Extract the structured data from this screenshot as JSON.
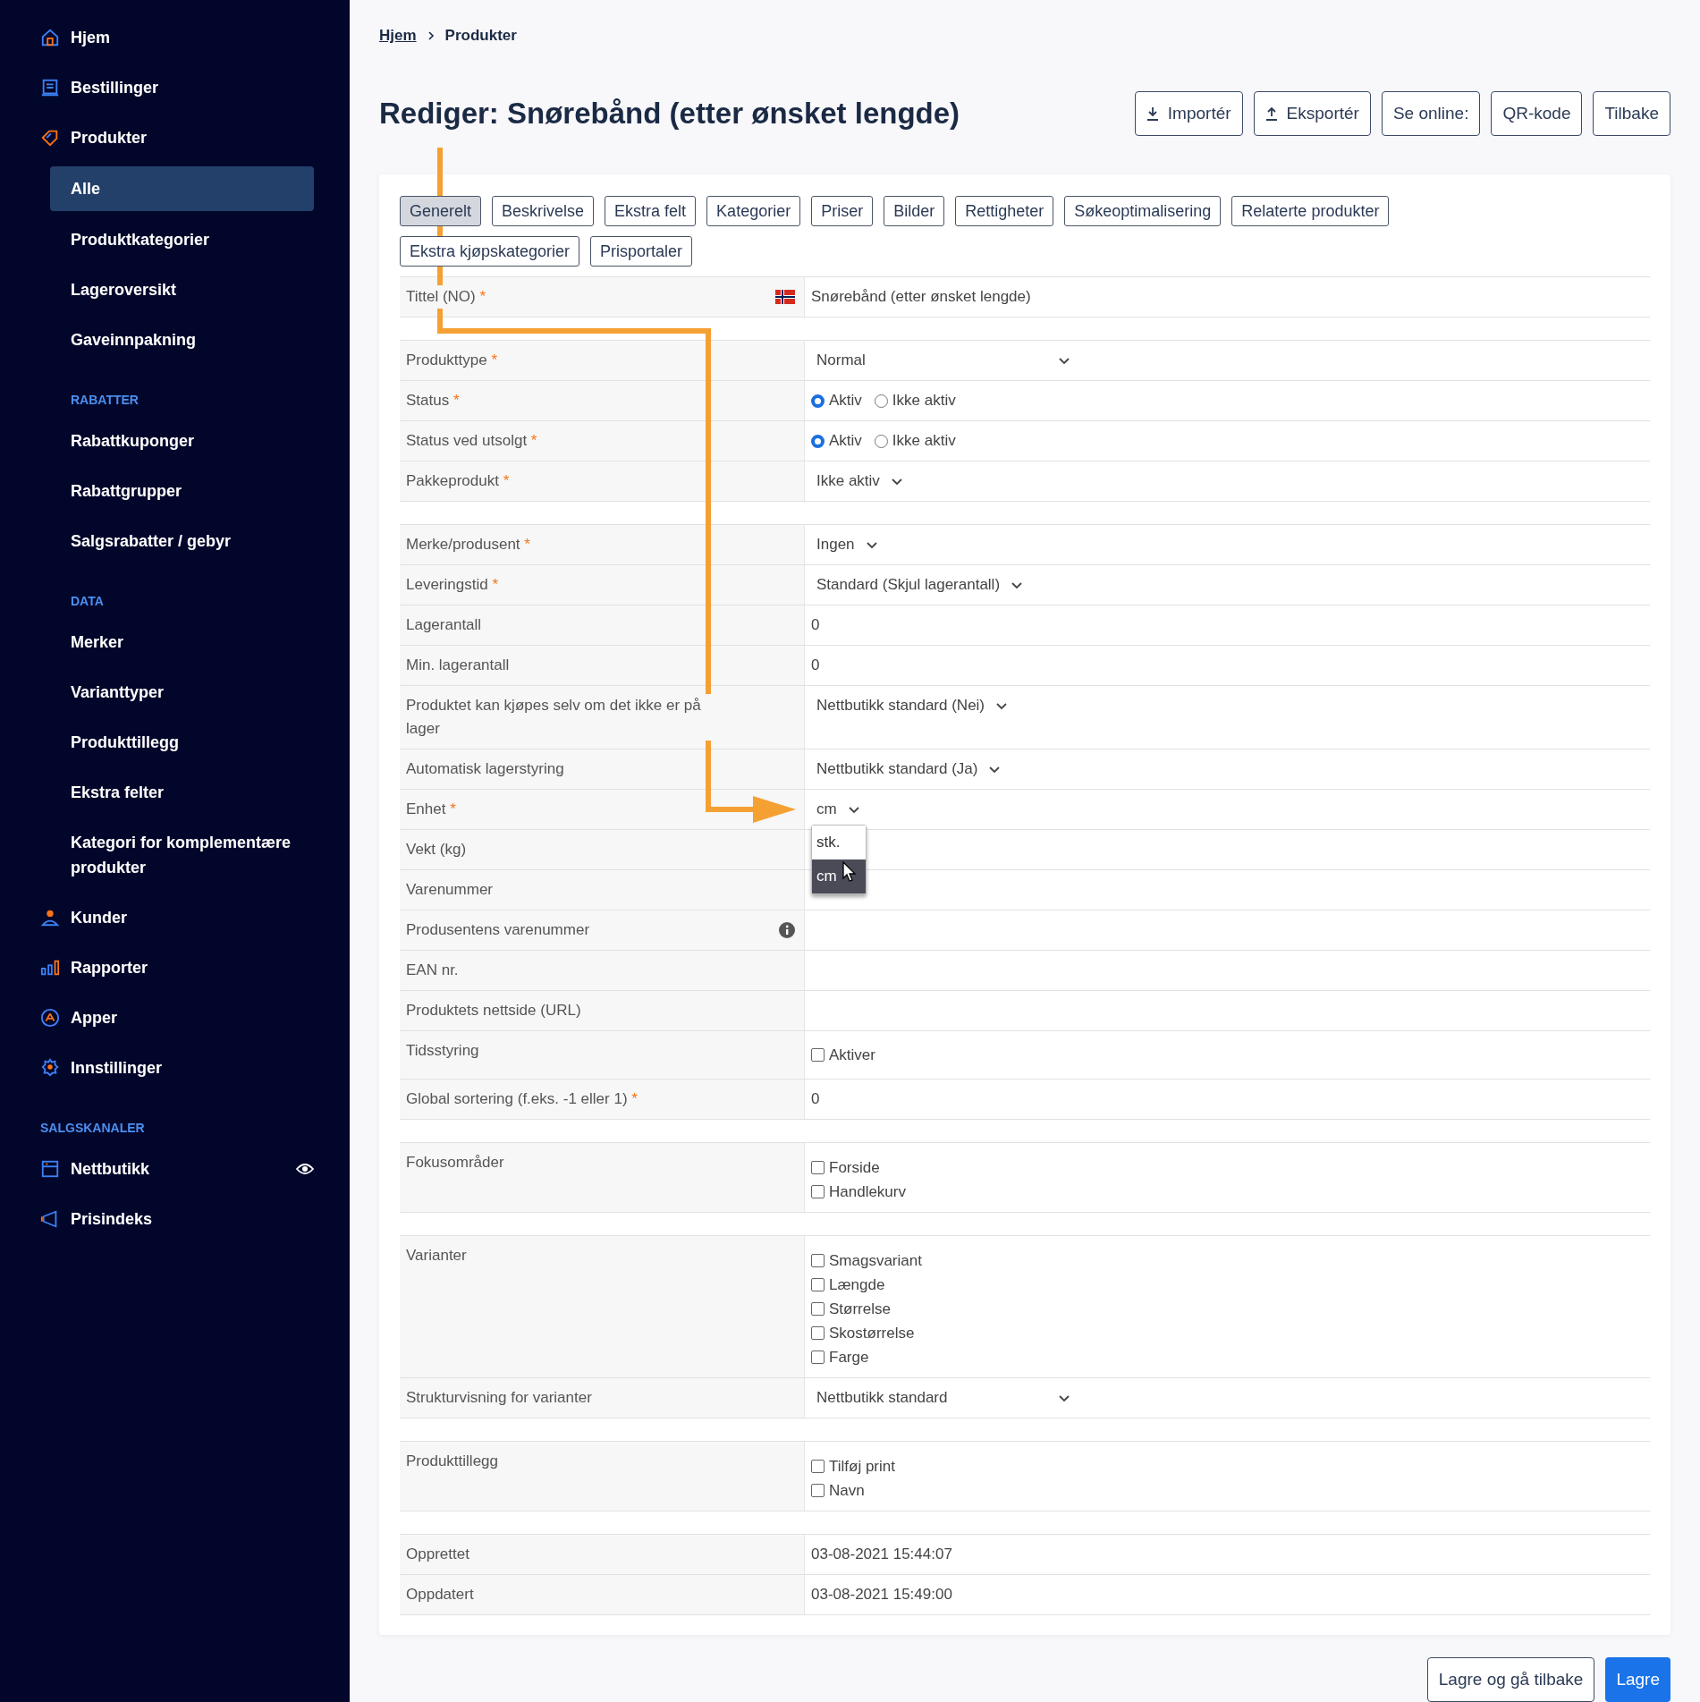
{
  "sidebar": {
    "entries": [
      {
        "kind": "nav",
        "label": "Hjem"
      },
      {
        "kind": "nav",
        "label": "Bestillinger"
      },
      {
        "kind": "nav",
        "label": "Produkter"
      },
      {
        "kind": "sub",
        "label": "Alle",
        "selected": true
      },
      {
        "kind": "sub",
        "label": "Produktkategorier",
        "selected": false
      },
      {
        "kind": "sub",
        "label": "Lageroversikt",
        "selected": false
      },
      {
        "kind": "sub",
        "label": "Gaveinnpakning",
        "selected": false
      },
      {
        "kind": "heading",
        "label": "RABATTER"
      },
      {
        "kind": "sub",
        "label": "Rabattkuponger",
        "selected": false
      },
      {
        "kind": "sub",
        "label": "Rabattgrupper",
        "selected": false
      },
      {
        "kind": "sub",
        "label": "Salgsrabatter / gebyr",
        "selected": false
      },
      {
        "kind": "heading",
        "label": "DATA"
      },
      {
        "kind": "sub",
        "label": "Merker",
        "selected": false
      },
      {
        "kind": "sub",
        "label": "Varianttyper",
        "selected": false
      },
      {
        "kind": "sub",
        "label": "Produkttillegg",
        "selected": false
      },
      {
        "kind": "sub",
        "label": "Ekstra felter",
        "selected": false
      },
      {
        "kind": "sub",
        "label": "Kategori for komplementære produkter",
        "selected": false
      },
      {
        "kind": "nav",
        "label": "Kunder"
      },
      {
        "kind": "nav",
        "label": "Rapporter"
      },
      {
        "kind": "nav",
        "label": "Apper"
      },
      {
        "kind": "nav",
        "label": "Innstillinger"
      },
      {
        "kind": "heading",
        "label": "SALGSKANALER"
      },
      {
        "kind": "nav",
        "label": "Nettbutikk",
        "preview": true
      },
      {
        "kind": "nav",
        "label": "Prisindeks"
      }
    ]
  },
  "breadcrumb": [
    {
      "label": "Hjem",
      "kind": "link"
    },
    {
      "label": "Produkter",
      "kind": "current"
    }
  ],
  "title": "Rediger: Snørebånd (etter ønsket lengde)",
  "header_buttons": [
    {
      "label": "Importér",
      "kind": "import"
    },
    {
      "label": "Eksportér",
      "kind": "export"
    },
    {
      "label": "Se online:",
      "kind": "plain"
    },
    {
      "label": "QR-kode",
      "kind": "plain"
    },
    {
      "label": "Tilbake",
      "kind": "plain"
    }
  ],
  "tabs": [
    {
      "label": "Generelt",
      "selected": true
    },
    {
      "label": "Beskrivelse",
      "selected": false
    },
    {
      "label": "Ekstra felt",
      "selected": false
    },
    {
      "label": "Kategorier",
      "selected": false
    },
    {
      "label": "Priser",
      "selected": false
    },
    {
      "label": "Bilder",
      "selected": false
    },
    {
      "label": "Rettigheter",
      "selected": false
    },
    {
      "label": "Søkeoptimalisering",
      "selected": false
    },
    {
      "label": "Relaterte produkter",
      "selected": false
    },
    {
      "label": "Ekstra kjøpskategorier",
      "selected": false
    },
    {
      "label": "Prisportaler",
      "selected": false
    }
  ],
  "form": {
    "sections": [
      {
        "rows": [
          {
            "kind": "flag-text",
            "label": "Tittel (NO)",
            "marker": "*",
            "value": "Snørebånd (etter ønsket lengde)"
          }
        ]
      },
      {
        "rows": [
          {
            "kind": "select-wide",
            "label": "Produkttype",
            "marker": "*",
            "value": "Normal"
          },
          {
            "kind": "radio",
            "label": "Status",
            "marker": "*",
            "options": [
              {
                "label": "Aktiv",
                "selected": true
              },
              {
                "label": "Ikke aktiv",
                "selected": false
              }
            ]
          },
          {
            "kind": "radio",
            "label": "Status ved utsolgt",
            "marker": "*",
            "options": [
              {
                "label": "Aktiv",
                "selected": true
              },
              {
                "label": "Ikke aktiv",
                "selected": false
              }
            ]
          },
          {
            "kind": "select",
            "label": "Pakkeprodukt",
            "marker": "*",
            "value": "Ikke aktiv"
          }
        ]
      },
      {
        "rows": [
          {
            "kind": "select",
            "label": "Merke/produsent",
            "marker": "*",
            "value": "Ingen"
          },
          {
            "kind": "select",
            "label": "Leveringstid",
            "marker": "*",
            "value": "Standard (Skjul lagerantall)"
          },
          {
            "kind": "text",
            "label": "Lagerantall",
            "value": "0"
          },
          {
            "kind": "text",
            "label": "Min. lagerantall",
            "value": "0"
          },
          {
            "kind": "select",
            "label": "Produktet kan kjøpes selv om det ikke er på lager",
            "value": "Nettbutikk standard (Nei)"
          },
          {
            "kind": "select",
            "label": "Automatisk lagerstyring",
            "value": "Nettbutikk standard (Ja)"
          },
          {
            "kind": "select",
            "label": "Enhet",
            "marker": "*",
            "value": "cm",
            "dropdown": [
              {
                "label": "stk.",
                "selected": false
              },
              {
                "label": "cm",
                "selected": true
              }
            ]
          },
          {
            "kind": "empty",
            "label": "Vekt (kg)"
          },
          {
            "kind": "empty",
            "label": "Varenummer"
          },
          {
            "kind": "info-empty",
            "label": "Produsentens varenummer"
          },
          {
            "kind": "empty",
            "label": "EAN nr."
          },
          {
            "kind": "empty",
            "label": "Produktets nettside (URL)"
          },
          {
            "kind": "checks",
            "label": "Tidsstyring",
            "options": [
              {
                "label": "Aktiver",
                "checked": false
              }
            ]
          },
          {
            "kind": "text",
            "label": "Global sortering (f.eks. -1 eller 1)",
            "marker": "*",
            "value": "0"
          }
        ]
      },
      {
        "rows": [
          {
            "kind": "checks",
            "label": "Fokusområder",
            "options": [
              {
                "label": "Forside",
                "checked": false
              },
              {
                "label": "Handlekurv",
                "checked": false
              }
            ]
          }
        ]
      },
      {
        "rows": [
          {
            "kind": "checks",
            "label": "Varianter",
            "options": [
              {
                "label": "Smagsvariant",
                "checked": false
              },
              {
                "label": "Længde",
                "checked": false
              },
              {
                "label": "Størrelse",
                "checked": false
              },
              {
                "label": "Skostørrelse",
                "checked": false
              },
              {
                "label": "Farge",
                "checked": false
              }
            ]
          },
          {
            "kind": "select-wide",
            "label": "Strukturvisning for varianter",
            "value": "Nettbutikk standard"
          }
        ]
      },
      {
        "rows": [
          {
            "kind": "checks",
            "label": "Produkttillegg",
            "options": [
              {
                "label": "Tilføj print",
                "checked": false
              },
              {
                "label": "Navn",
                "checked": false
              }
            ]
          }
        ]
      },
      {
        "rows": [
          {
            "kind": "text",
            "label": "Opprettet",
            "value": "03-08-2021 15:44:07"
          },
          {
            "kind": "text",
            "label": "Oppdatert",
            "value": "03-08-2021 15:49:00"
          }
        ]
      }
    ]
  },
  "footer_buttons": [
    {
      "label": "Lagre og gå tilbake",
      "kind": "secondary"
    },
    {
      "label": "Lagre",
      "kind": "primary"
    }
  ]
}
